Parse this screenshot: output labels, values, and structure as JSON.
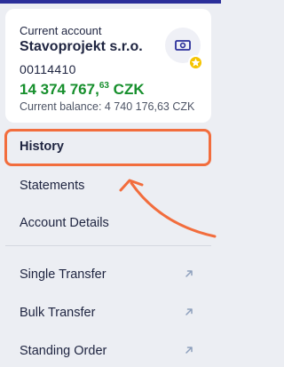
{
  "account_card": {
    "type_label": "Current account",
    "account_name": "Stavoprojekt s.r.o.",
    "account_number": "00114410",
    "balance_whole": "14 374 767,",
    "balance_decimal": "63",
    "currency": "CZK",
    "current_balance_text": "Current balance: 4 740 176,63 CZK"
  },
  "menu": {
    "history": "History",
    "statements": "Statements",
    "account_details": "Account Details",
    "single_transfer": "Single Transfer",
    "bulk_transfer": "Bulk Transfer",
    "standing_order": "Standing Order"
  },
  "icons": {
    "account": "cash-icon",
    "favorite": "star-icon",
    "external": "arrow-up-right-icon"
  },
  "colors": {
    "brand": "#2b2f9a",
    "balance": "#168f2c",
    "highlight": "#f26d3d",
    "favorite": "#f5c400"
  }
}
